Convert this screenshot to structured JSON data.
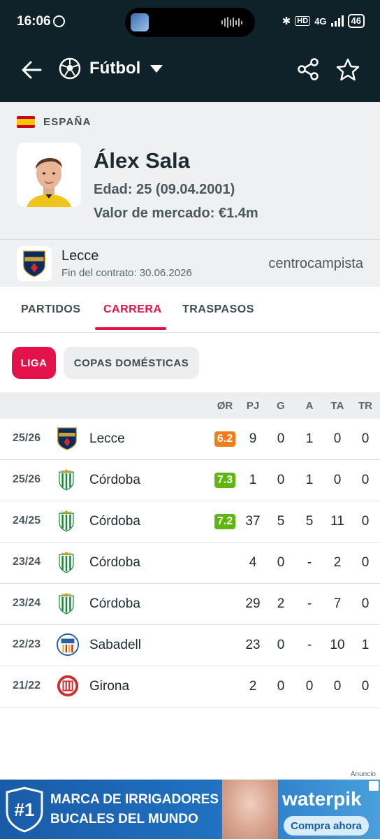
{
  "status_bar": {
    "time": "16:06",
    "network": "4G",
    "hd": "HD",
    "battery": "46"
  },
  "app_bar": {
    "sport": "Fútbol"
  },
  "player": {
    "country": "ESPAÑA",
    "name": "Álex Sala",
    "age": "Edad: 25 (09.04.2001)",
    "market_value": "Valor de mercado: €1.4m"
  },
  "club": {
    "name": "Lecce",
    "contract": "Fin del contrato: 30.06.2026",
    "position": "centrocampista"
  },
  "tabs": [
    {
      "label": "PARTIDOS",
      "active": false
    },
    {
      "label": "CARRERA",
      "active": true
    },
    {
      "label": "TRASPASOS",
      "active": false
    }
  ],
  "filters": {
    "active": "LIGA",
    "inactive": "COPAS DOMÉSTICAS"
  },
  "table": {
    "headers": {
      "rating": "ØR",
      "pj": "PJ",
      "g": "G",
      "a": "A",
      "ta": "TA",
      "tr": "TR"
    },
    "rows": [
      {
        "season": "25/26",
        "team": "Lecce",
        "crest": "lecce",
        "rating": "6.2",
        "rating_color": "#f07c1b",
        "pj": "9",
        "g": "0",
        "a": "1",
        "ta": "0",
        "tr": "0"
      },
      {
        "season": "25/26",
        "team": "Córdoba",
        "crest": "cordoba",
        "rating": "7.3",
        "rating_color": "#5fb611",
        "pj": "1",
        "g": "0",
        "a": "1",
        "ta": "0",
        "tr": "0"
      },
      {
        "season": "24/25",
        "team": "Córdoba",
        "crest": "cordoba",
        "rating": "7.2",
        "rating_color": "#5fb611",
        "pj": "37",
        "g": "5",
        "a": "5",
        "ta": "11",
        "tr": "0"
      },
      {
        "season": "23/24",
        "team": "Córdoba",
        "crest": "cordoba",
        "rating": "",
        "rating_color": "",
        "pj": "4",
        "g": "0",
        "a": "-",
        "ta": "2",
        "tr": "0"
      },
      {
        "season": "23/24",
        "team": "Córdoba",
        "crest": "cordoba",
        "rating": "",
        "rating_color": "",
        "pj": "29",
        "g": "2",
        "a": "-",
        "ta": "7",
        "tr": "0"
      },
      {
        "season": "22/23",
        "team": "Sabadell",
        "crest": "sabadell",
        "rating": "",
        "rating_color": "",
        "pj": "23",
        "g": "0",
        "a": "-",
        "ta": "10",
        "tr": "1"
      },
      {
        "season": "21/22",
        "team": "Girona",
        "crest": "girona",
        "rating": "",
        "rating_color": "",
        "pj": "2",
        "g": "0",
        "a": "0",
        "ta": "0",
        "tr": "0"
      }
    ]
  },
  "ad": {
    "label": "Anuncio",
    "badge": "#1",
    "line1": "MARCA DE IRRIGADORES",
    "line2": "BUCALES DEL MUNDO",
    "brand": "waterpik",
    "cta": "Compra ahora"
  },
  "colors": {
    "header_bg": "#0f2229",
    "accent": "#e3124b",
    "rating_orange": "#f07c1b",
    "rating_green": "#5fb611"
  }
}
